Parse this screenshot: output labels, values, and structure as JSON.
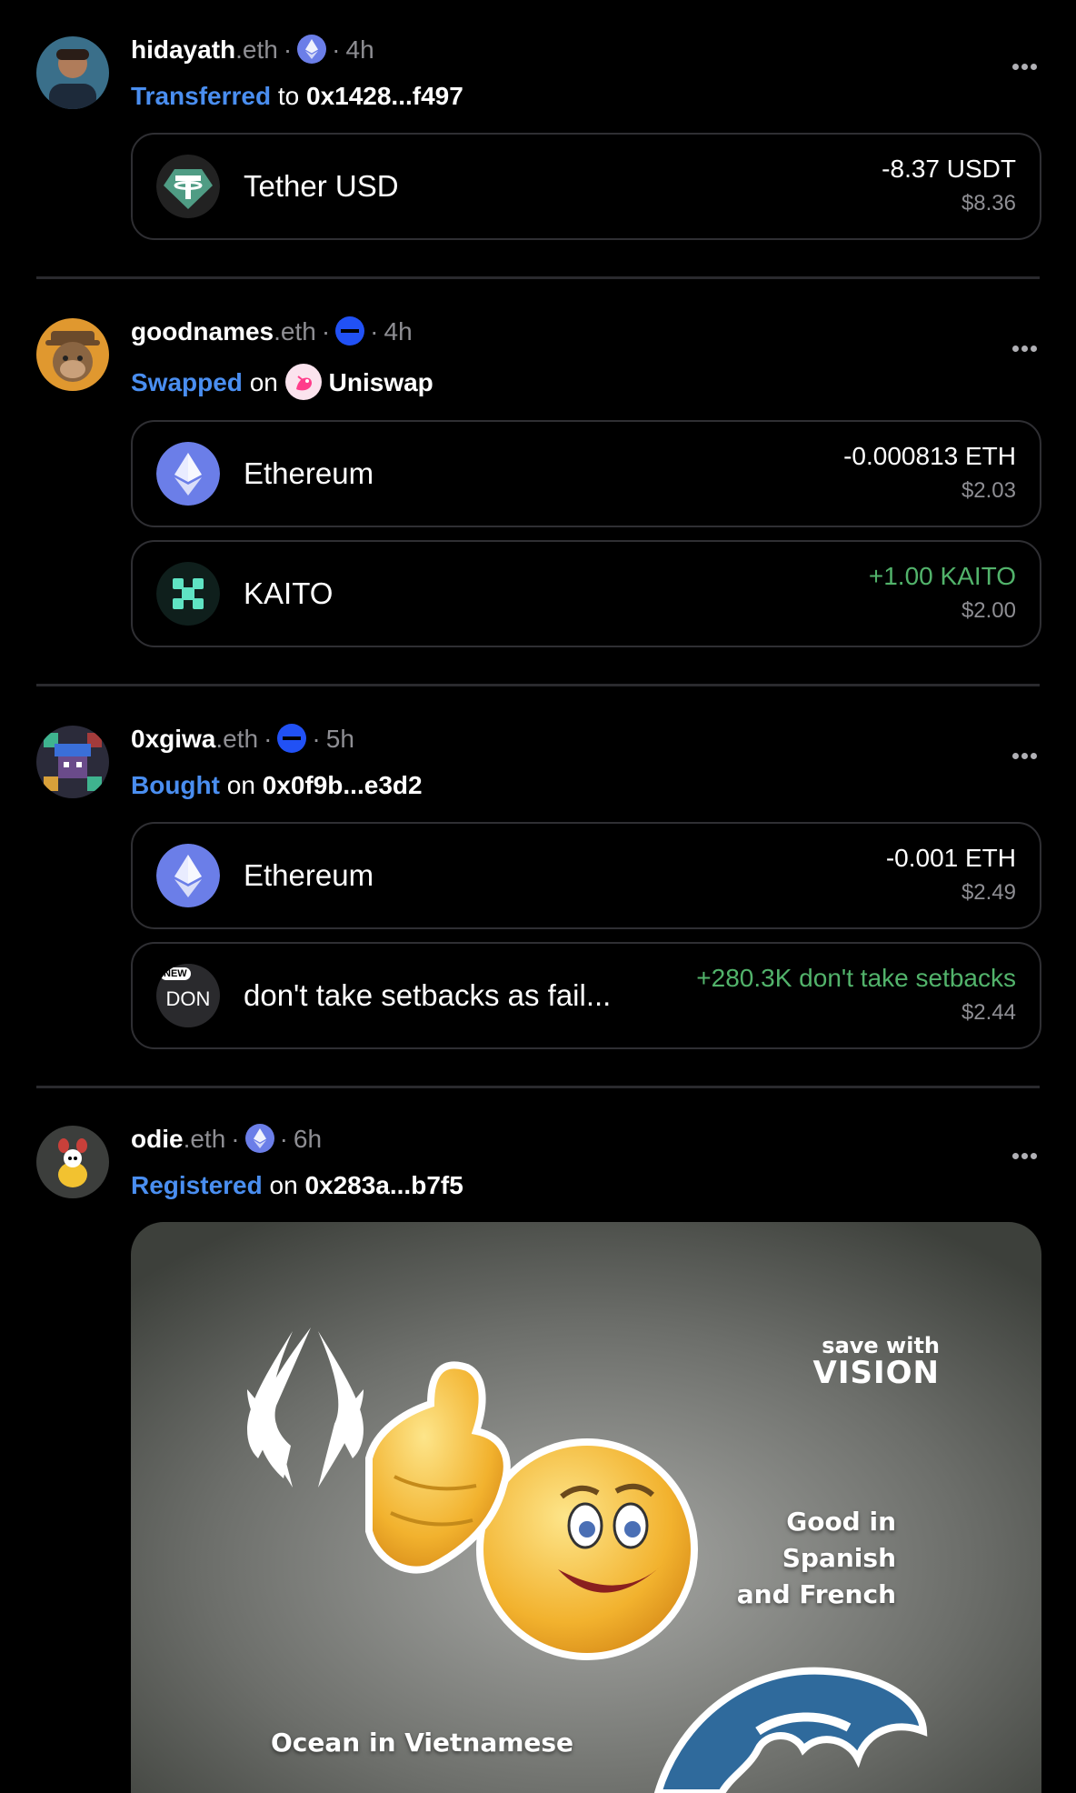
{
  "posts": [
    {
      "user": "hidayath",
      "suffix": ".eth",
      "chain": "ethereum",
      "time": "4h",
      "verb": "Transferred",
      "prep": "to",
      "target": "0x1428...f497",
      "tokens": [
        {
          "name": "Tether USD",
          "amount": "-8.37 USDT",
          "usd": "$8.36",
          "icon": "tether-icon"
        }
      ]
    },
    {
      "user": "goodnames",
      "suffix": ".eth",
      "chain": "base",
      "time": "4h",
      "verb": "Swapped",
      "prep": "on",
      "target": "Uniswap",
      "tokens": [
        {
          "name": "Ethereum",
          "amount": "-0.000813 ETH",
          "usd": "$2.03",
          "icon": "ethereum-icon"
        },
        {
          "name": "KAITO",
          "amount": "+1.00 KAITO",
          "usd": "$2.00",
          "icon": "kaito-icon"
        }
      ]
    },
    {
      "user": "0xgiwa",
      "suffix": ".eth",
      "chain": "base",
      "time": "5h",
      "verb": "Bought",
      "prep": "on",
      "target": "0x0f9b...e3d2",
      "tokens": [
        {
          "name": "Ethereum",
          "amount": "-0.001 ETH",
          "usd": "$2.49",
          "icon": "ethereum-icon"
        },
        {
          "name": "don't take setbacks as fail...",
          "amount": "+280.3K don't take setbacks",
          "usd": "$2.44",
          "icon": "don-token-icon",
          "badge_new": "NEW",
          "badge_ticker": "DON"
        }
      ]
    },
    {
      "user": "odie",
      "suffix": ".eth",
      "chain": "ethereum",
      "time": "6h",
      "verb": "Registered",
      "prep": "on",
      "target": "0x283a...b7f5",
      "nft": {
        "brand_line1": "save with",
        "brand_line2": "VISION",
        "caption_right": [
          "Good in",
          "Spanish",
          "and French"
        ],
        "caption_bottom": "Ocean in Vietnamese"
      }
    }
  ],
  "colors": {
    "accent": "#4a8ef0",
    "positive": "#52b36b",
    "muted": "#8e8e93",
    "border": "#2f2f33"
  }
}
